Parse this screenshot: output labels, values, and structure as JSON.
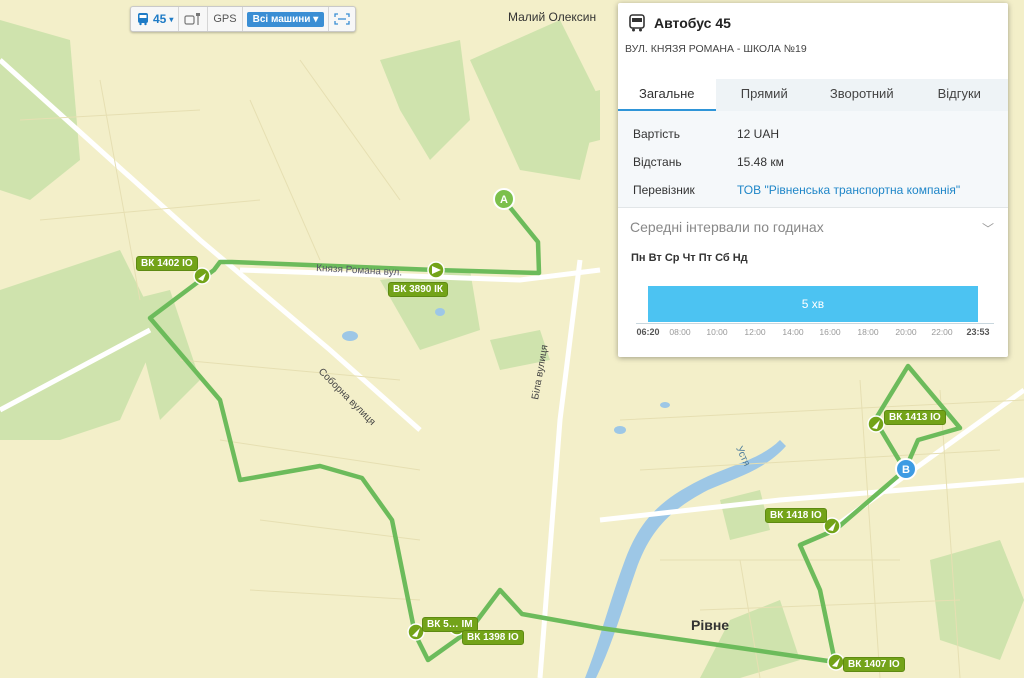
{
  "toolbar": {
    "route_number": "45",
    "gps_label": "GPS",
    "vehicles_label": "Всі машини"
  },
  "panel": {
    "title": "Автобус 45",
    "subtitle": "ВУЛ. КНЯЗЯ РОМАНА - ШКОЛА №19",
    "tabs": [
      "Загальне",
      "Прямий",
      "Зворотний",
      "Відгуки"
    ],
    "active_tab": "Загальне",
    "rows": [
      {
        "key": "Вартість",
        "value": "12 UAH"
      },
      {
        "key": "Відстань",
        "value": "15.48 км"
      },
      {
        "key": "Перевізник",
        "value": "ТОВ \"Рівненська транспортна компанія\""
      }
    ],
    "intervals_title": "Середні інтервали по годинах",
    "days": "Пн Вт Ср Чт Пт Сб Нд",
    "interval_value": "5 хв",
    "hour_ticks": [
      "06:20",
      "08:00",
      "10:00",
      "12:00",
      "14:00",
      "16:00",
      "18:00",
      "20:00",
      "22:00",
      "23:53"
    ]
  },
  "map": {
    "place_top": "Малий Олексин",
    "city": "Рівне",
    "street_sobor": "Соборна вулиця",
    "street_bila": "Біла вулиця",
    "street_knyazya": "Князя Романа вул.",
    "river": "Устя",
    "start_marker": "A",
    "end_marker": "B",
    "vehicles": [
      "ВК 1402 ІО",
      "ВК 3890 ІК",
      "ВК 1413 ІО",
      "ВК 1418 ІО",
      "ВК 5… ІМ",
      "ВК 1398 ІО",
      "ВК 1407 ІО"
    ]
  },
  "colors": {
    "route": "#6cbb5b",
    "accent": "#2f95d8",
    "vehicle": "#73a319",
    "interval_bar": "#4cc3f2"
  }
}
